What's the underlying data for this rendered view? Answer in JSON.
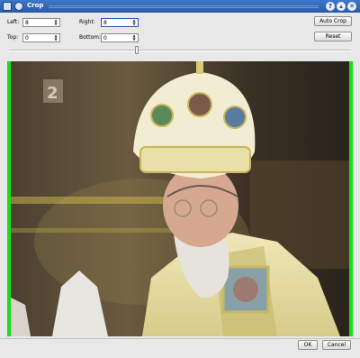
{
  "window": {
    "title": "Crop"
  },
  "crop": {
    "left_label": "Left:",
    "left_value": "8",
    "right_label": "Right:",
    "right_value": "8",
    "top_label": "Top:",
    "top_value": "0",
    "bottom_label": "Bottom:",
    "bottom_value": "0"
  },
  "buttons": {
    "auto_crop": "Auto Crop",
    "reset": "Reset",
    "ok": "OK",
    "cancel": "Cancel"
  },
  "preview": {
    "channel_logo": "2"
  },
  "colors": {
    "titlebar": "#2a5aa8",
    "crop_guides": "#16e016"
  }
}
